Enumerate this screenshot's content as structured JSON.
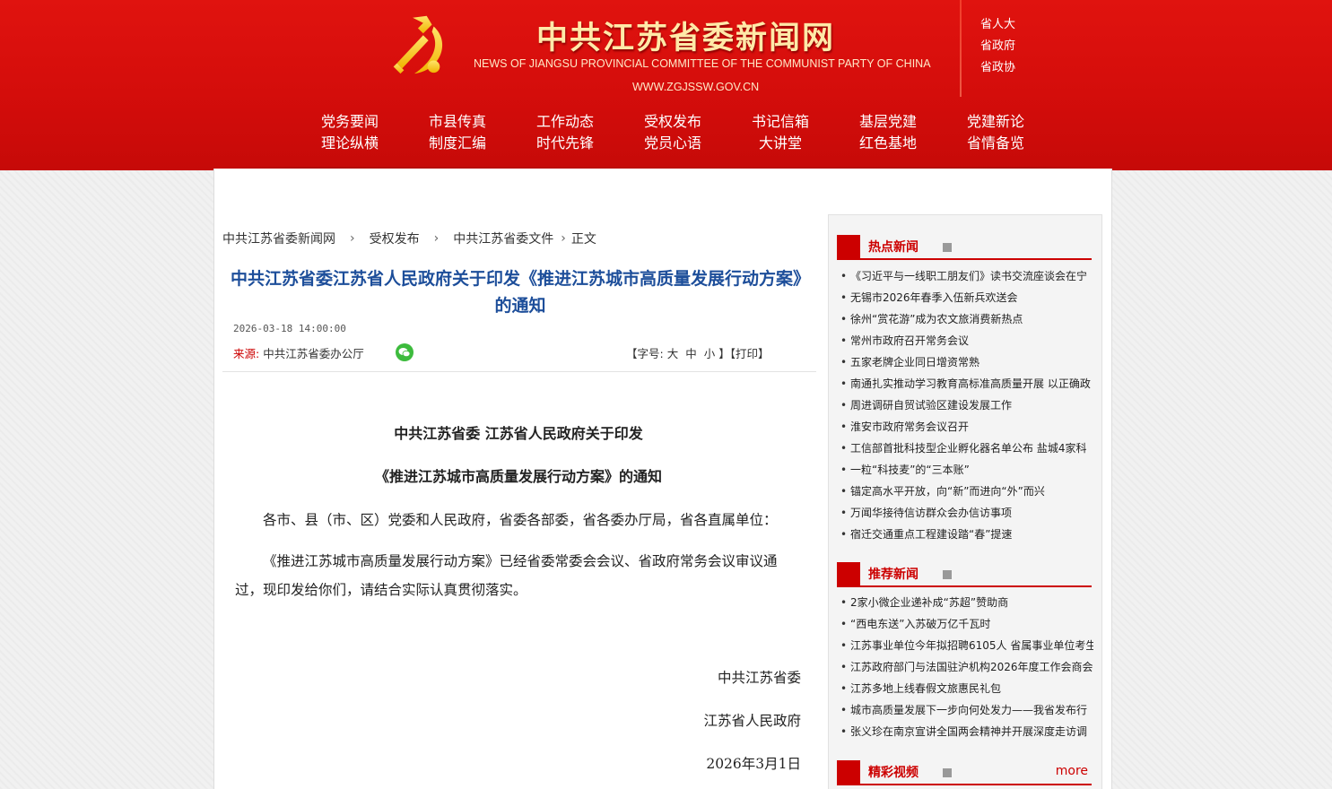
{
  "header": {
    "site_title": "中共江苏省委新闻网",
    "site_title_en": "NEWS  OF JIANGSU PROVINCIAL COMMITTEE OF THE COMMUNIST PARTY OF CHINA",
    "site_url": "WWW.ZGJSSW.GOV.CN",
    "quick_links": [
      "省人大",
      "省政府",
      "省政协"
    ],
    "nav": [
      "党务要闻",
      "市县传真",
      "工作动态",
      "受权发布",
      "书记信箱",
      "基层党建",
      "党建新论",
      "理论纵横",
      "制度汇编",
      "时代先锋",
      "党员心语",
      "大讲堂",
      "红色基地",
      "省情备览"
    ]
  },
  "breadcrumb": [
    "中共江苏省委新闻网",
    "受权发布",
    "中共江苏省委文件",
    "正文"
  ],
  "article": {
    "title": "中共江苏省委江苏省人民政府关于印发《推进江苏城市高质量发展行动方案》的通知",
    "date": "2026-03-18 14:00:00",
    "source_label": "来源:",
    "source": "中共江苏省委办公厅",
    "font_control": {
      "prefix": "【字号:",
      "large": "大",
      "medium": "中",
      "small": "小",
      "mid": "】【",
      "print": "打印",
      "suffix": "】"
    },
    "heading_line1": "中共江苏省委  江苏省人民政府关于印发",
    "heading_line2": "《推进江苏城市高质量发展行动方案》的通知",
    "salutation": "各市、县（市、区）党委和人民政府，省委各部委，省各委办厅局，省各直属单位：",
    "paragraph": "《推进江苏城市高质量发展行动方案》已经省委常委会会议、省政府常务会议审议通过，现印发给你们，请结合实际认真贯彻落实。",
    "signature1": "中共江苏省委",
    "signature2": "江苏省人民政府",
    "sign_date": "2026年3月1日"
  },
  "sidebar": {
    "hot": {
      "title": "热点新闻",
      "items": [
        "《习近平与一线职工朋友们》读书交流座谈会在宁",
        "无锡市2026年春季入伍新兵欢送会",
        "徐州“赏花游”成为农文旅消费新热点",
        "常州市政府召开常务会议",
        "五家老牌企业同日增资常熟",
        "南通扎实推动学习教育高标准高质量开展 以正确政",
        "周进调研自贸试验区建设发展工作",
        "淮安市政府常务会议召开",
        "工信部首批科技型企业孵化器名单公布 盐城4家科",
        "一粒“科技麦”的“三本账”",
        "锚定高水平开放，向“新”而进向“外”而兴",
        "万闻华接待信访群众会办信访事项",
        "宿迁交通重点工程建设踏“春”提速"
      ]
    },
    "recommend": {
      "title": "推荐新闻",
      "items": [
        "2家小微企业递补成“苏超”赞助商",
        "“西电东送”入苏破万亿千瓦时",
        "江苏事业单位今年拟招聘6105人 省属事业单位考生",
        "江苏政府部门与法国驻沪机构2026年度工作会商会",
        "江苏多地上线春假文旅惠民礼包",
        "城市高质量发展下一步向何处发力——我省发布行",
        "张义珍在南京宣讲全国两会精神并开展深度走访调"
      ]
    },
    "video": {
      "title": "精彩视频",
      "more": "more"
    }
  },
  "icons": {
    "emblem": "party-emblem-icon",
    "wechat": "wechat-icon"
  }
}
